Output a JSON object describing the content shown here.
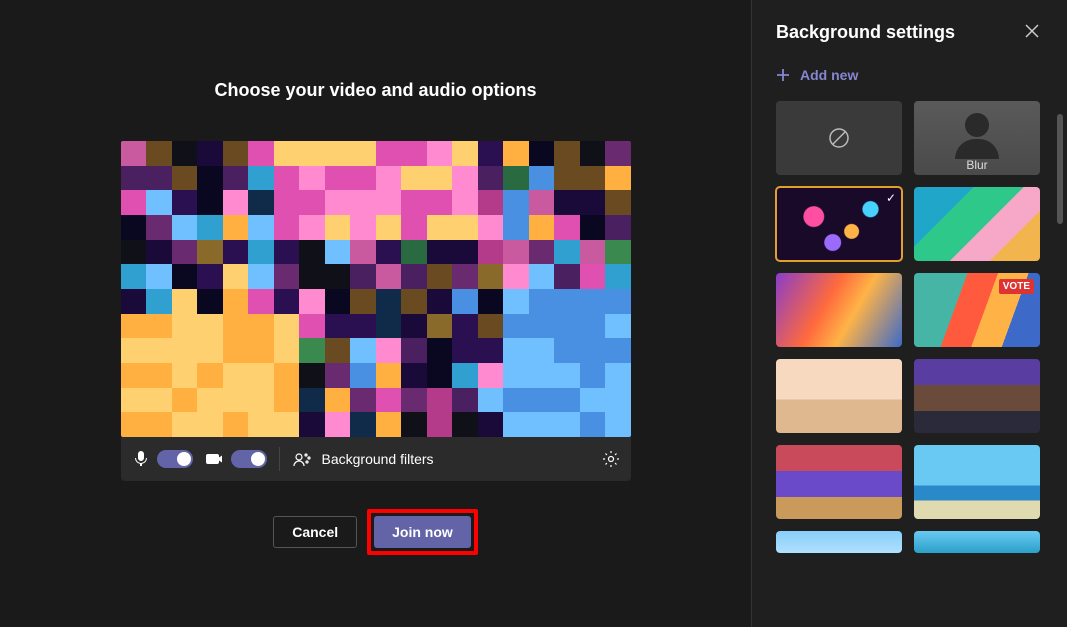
{
  "main": {
    "title": "Choose your video and audio options",
    "controls": {
      "mic_on": true,
      "camera_on": true,
      "bg_filters_label": "Background filters"
    },
    "actions": {
      "cancel": "Cancel",
      "join": "Join now"
    }
  },
  "panel": {
    "title": "Background settings",
    "add_new": "Add new",
    "tiles": {
      "none": "",
      "blur": "Blur"
    },
    "selected_index": 2
  }
}
